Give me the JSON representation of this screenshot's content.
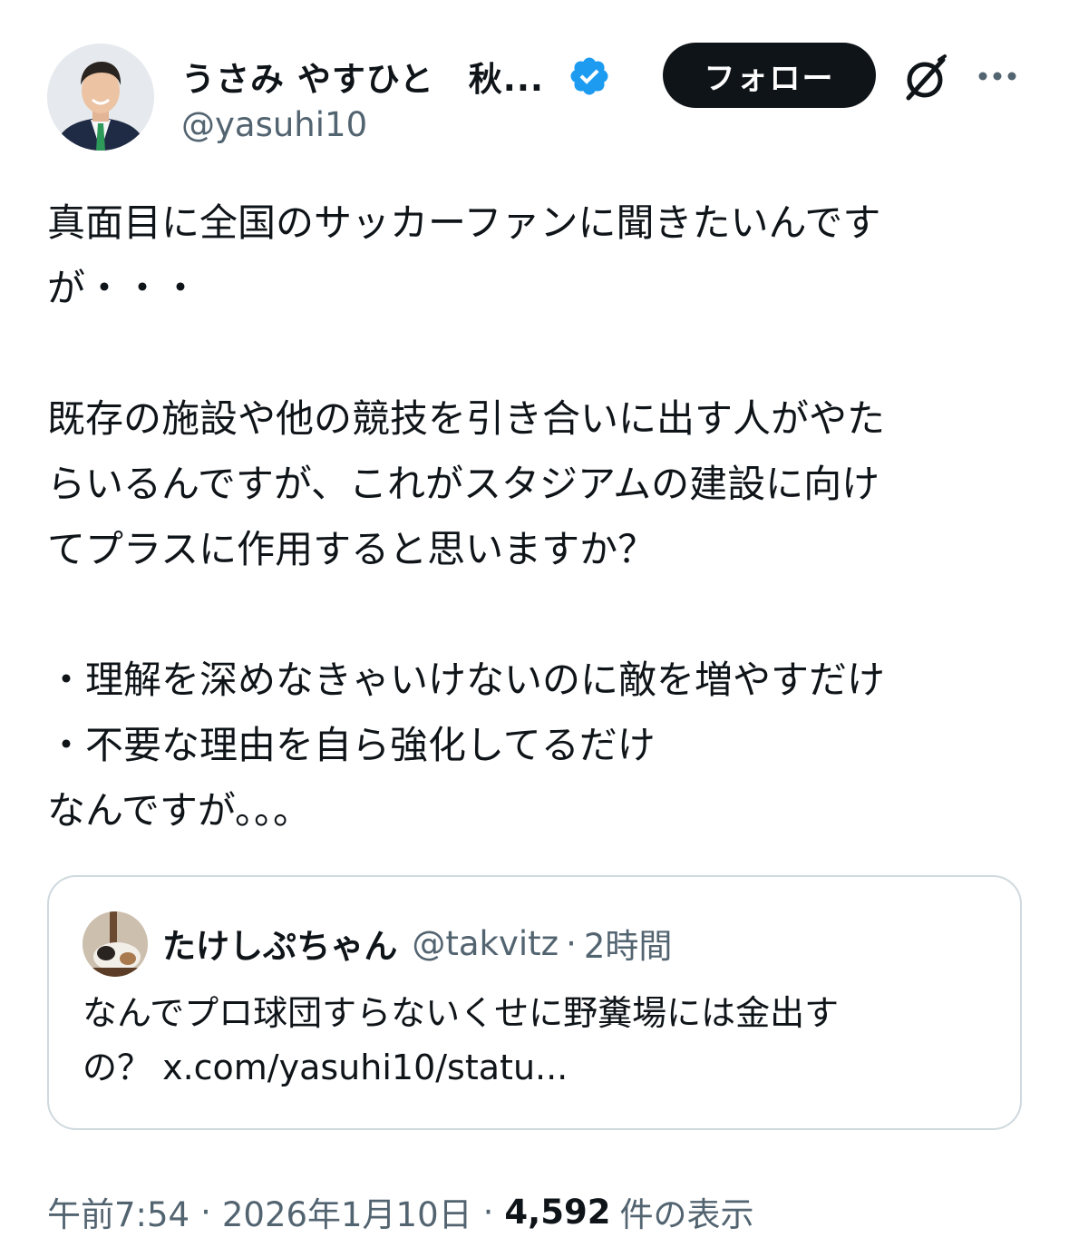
{
  "author": {
    "display_name": "うさみ やすひと　秋...",
    "handle": "@yasuhi10",
    "verified_icon": "verified-badge-icon"
  },
  "header": {
    "follow_label": "フォロー",
    "grok_icon": "grok-icon",
    "more_icon": "more-dots-icon"
  },
  "tweet": {
    "lines": [
      "真面目に全国のサッカーファンに聞きたいんです",
      "が・・・",
      "",
      "既存の施設や他の競技を引き合いに出す人がやた",
      "らいるんですが、これがスタジアムの建設に向け",
      "てプラスに作用すると思いますか？",
      "",
      "・理解を深めなきゃいけないのに敵を増やすだけ",
      "・不要な理由を自ら強化してるだけ",
      "なんですが。。。"
    ]
  },
  "quote": {
    "name": "たけしぷちゃん",
    "handle": "@takvitz",
    "separator": "·",
    "time": "2時間",
    "line1": "なんでプロ球団すらないくせに野糞場には金出す",
    "line2": "の？ x.com/yasuhi10/statu..."
  },
  "meta": {
    "time": "午前7:54",
    "separator": "·",
    "date": "2026年1月10日",
    "views_count": "4,592",
    "views_label": "件の表示"
  },
  "colors": {
    "text": "#0f1419",
    "secondary": "#536471",
    "verified": "#1d9bf0",
    "border": "#cfd9de",
    "follow_bg": "#0f1419"
  }
}
